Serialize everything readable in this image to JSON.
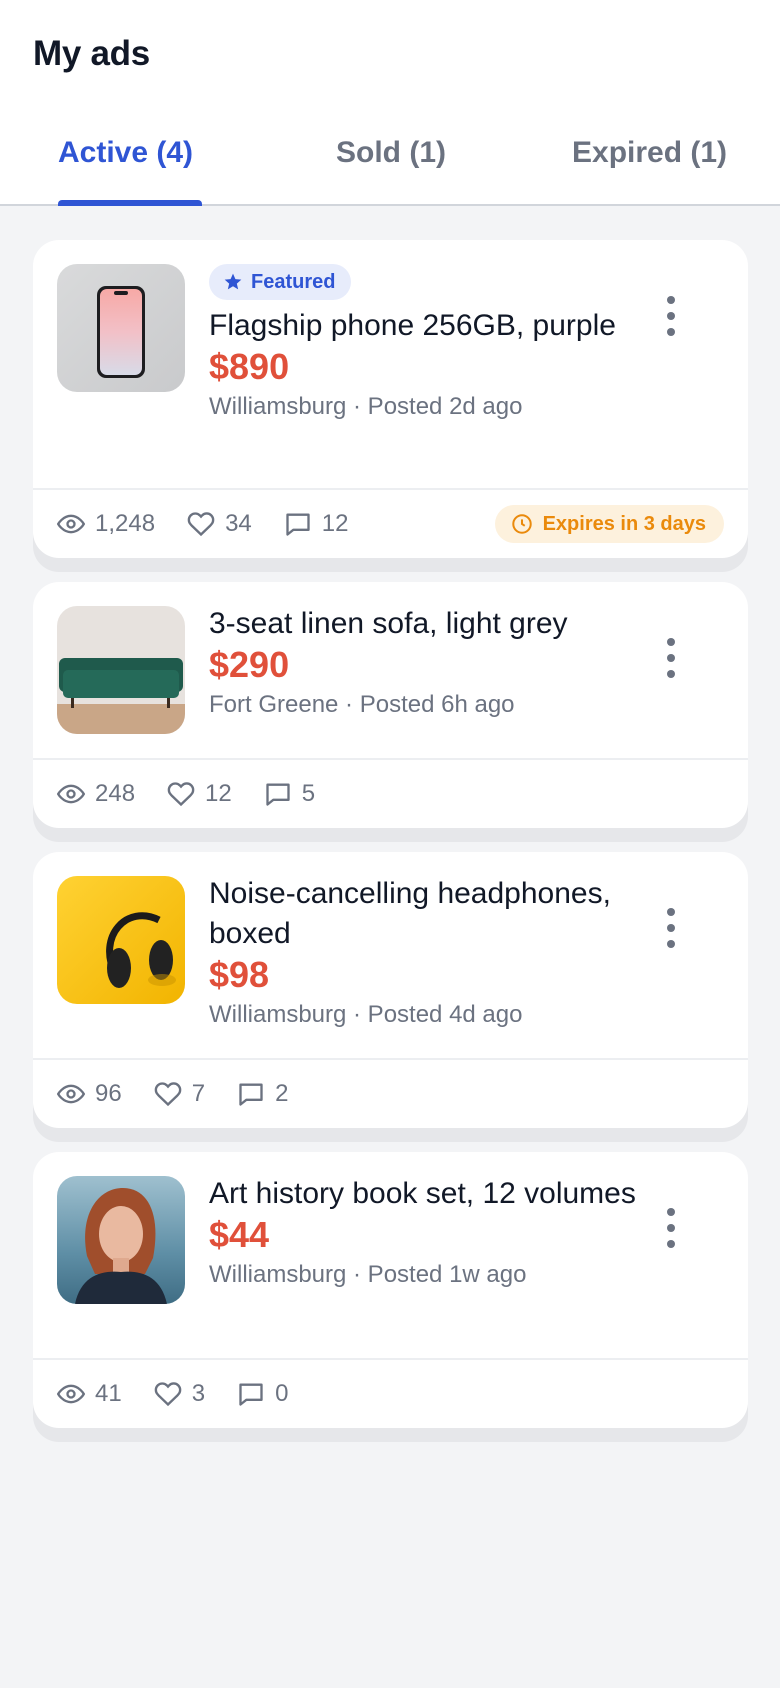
{
  "header": {
    "title": "My ads"
  },
  "tabs": [
    {
      "label": "Active (4)",
      "active": true
    },
    {
      "label": "Sold (1)",
      "active": false
    },
    {
      "label": "Expired (1)",
      "active": false
    }
  ],
  "ads": [
    {
      "featured_label": "Featured",
      "title": "Flagship phone 256GB, purple",
      "price": "$890",
      "meta": "Williamsburg · Posted 2d ago",
      "views": "1,248",
      "likes": "34",
      "comments": "12",
      "expires": "Expires in 3 days",
      "thumb": "phone"
    },
    {
      "title": "3-seat linen sofa, light grey",
      "price": "$290",
      "meta": "Fort Greene · Posted 6h ago",
      "views": "248",
      "likes": "12",
      "comments": "5",
      "thumb": "sofa"
    },
    {
      "title": "Noise-cancelling headphones, boxed",
      "price": "$98",
      "meta": "Williamsburg · Posted 4d ago",
      "views": "96",
      "likes": "7",
      "comments": "2",
      "thumb": "headphones"
    },
    {
      "title": "Art history book set, 12 volumes",
      "price": "$44",
      "meta": "Williamsburg · Posted 1w ago",
      "views": "41",
      "likes": "3",
      "comments": "0",
      "thumb": "portrait"
    }
  ],
  "colors": {
    "accent": "#2f55d4",
    "price": "#e0503a",
    "warning": "#ea8a0c",
    "muted": "#6b7280"
  },
  "icons": {
    "featured": "star-icon",
    "views": "eye-icon",
    "likes": "heart-icon",
    "comments": "comment-icon",
    "expires": "clock-icon",
    "more": "more-vertical-icon"
  }
}
